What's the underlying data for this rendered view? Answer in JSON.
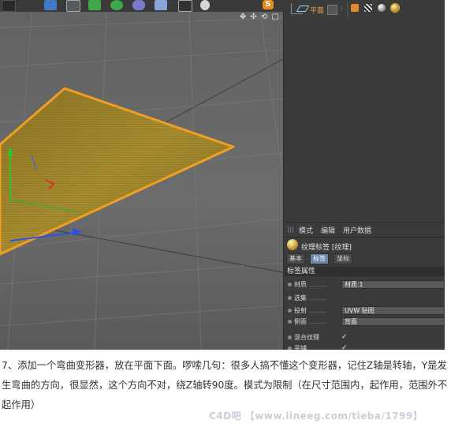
{
  "toolbar": {
    "icons": [
      "cube-icon",
      "spline-icon",
      "nurbs-icon",
      "array-icon",
      "deformer-icon",
      "floor-icon",
      "camera-icon",
      "light-icon"
    ],
    "app_badge": "S"
  },
  "viewport": {
    "nav_icons": "✥ ✣ ⟲ ▢"
  },
  "object_manager": {
    "object_name": "平面",
    "flag_dots": "⋮"
  },
  "attribute_manager": {
    "menu": [
      "模式",
      "编辑",
      "用户数据"
    ],
    "title": "纹理标签 [纹理]",
    "tabs": [
      "基本",
      "标签",
      "坐标"
    ],
    "active_tab": "标签",
    "section": "标签属性",
    "properties": [
      {
        "label": "材质",
        "dots": ".........",
        "value": "材质.1"
      },
      {
        "label": "选集",
        "dots": ".........",
        "value": ""
      },
      {
        "label": "投射",
        "dots": ".........",
        "value": "UVW 贴图"
      },
      {
        "label": "侧面",
        "dots": ".........",
        "value": "背面"
      },
      {
        "label": "混合纹理",
        "dots": "",
        "value": "✓"
      },
      {
        "label": "平铺",
        "dots": ".........",
        "value": "✓"
      }
    ]
  },
  "caption": {
    "text": "7、添加一个弯曲变形器，放在平面下面。啰嗦几句：很多人搞不懂这个变形器，记住Z轴是转轴，Y是发生弯曲的方向，很显然，这个方向不对，绕Z轴转90度。模式为限制（在尺寸范围内，起作用，范围外不起作用）"
  },
  "watermark": "C4D吧 【www.lineeg.com/tieba/1799】",
  "colors": {
    "selection": "#f0a020",
    "plane_fill": "#a0862a",
    "x_axis": "#e03030",
    "y_axis": "#30c030",
    "z_axis": "#3050e0",
    "active_tab": "#6d86a8"
  }
}
